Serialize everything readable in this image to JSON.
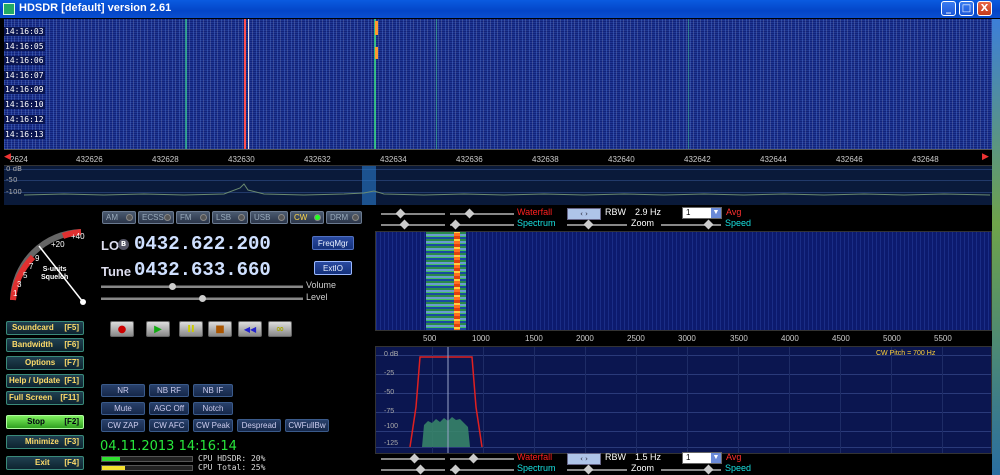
{
  "window": {
    "title": "HDSDR [default]  version 2.61",
    "min_glyph": "_",
    "max_glyph": "□",
    "close_glyph": "X"
  },
  "waterfall": {
    "timestamps": [
      "14:16:03",
      "14:16:05",
      "14:16:06",
      "14:16:07",
      "14:16:09",
      "14:16:10",
      "14:16:12",
      "14:16:13"
    ]
  },
  "freq_scale": {
    "labels": [
      "2624",
      "432626",
      "432628",
      "432630",
      "432632",
      "432634",
      "432636",
      "432638",
      "432640",
      "432642",
      "432644",
      "432646",
      "432648"
    ]
  },
  "spectrum_strip": {
    "labels": [
      "0 dB",
      "-50",
      "-100"
    ]
  },
  "smeter": {
    "scale_labels": [
      "+40",
      "+20",
      "9",
      "7",
      "5",
      "3",
      "1"
    ],
    "caption_1": "S-units",
    "caption_2": "Squelch"
  },
  "modes": [
    {
      "label": "AM"
    },
    {
      "label": "ECSS"
    },
    {
      "label": "FM"
    },
    {
      "label": "LSB"
    },
    {
      "label": "USB"
    },
    {
      "label": "CW",
      "active": true
    },
    {
      "label": "DRM"
    }
  ],
  "lo": {
    "label": "LO",
    "badge": "B",
    "value": "0432.622.200"
  },
  "tune": {
    "label": "Tune",
    "value": "0432.633.660"
  },
  "buttons": {
    "freqmgr": "FreqMgr",
    "extio": "ExtIO"
  },
  "sliders": {
    "volume": "Volume",
    "level": "Level",
    "volume_level": 0.35,
    "level_level": 0.5
  },
  "transport": {
    "record": "●",
    "play": "▶",
    "pause": "II",
    "stop": "■",
    "rewind": "◀◀",
    "loop": "∞"
  },
  "side_buttons": [
    {
      "label": "Soundcard",
      "key": "[F5]"
    },
    {
      "label": "Bandwidth",
      "key": "[F6]"
    },
    {
      "label": "Options",
      "key": "[F7]"
    },
    {
      "label": "Help / Update",
      "key": "[F1]"
    },
    {
      "label": "Full Screen",
      "key": "[F11]"
    },
    {
      "label": "Stop",
      "key": "[F2]"
    },
    {
      "label": "Minimize",
      "key": "[F3]"
    },
    {
      "label": "Exit",
      "key": "[F4]"
    }
  ],
  "dsp": {
    "row1": [
      "NR",
      "NB RF",
      "NB IF"
    ],
    "row2": [
      "Mute",
      "AGC Off",
      "Notch"
    ],
    "row3": [
      "CW ZAP",
      "CW AFC",
      "CW Peak",
      "Despread",
      "CWFullBw"
    ]
  },
  "status": {
    "clock": "04.11.2013 14:16:14",
    "cpu_hdsdr": "CPU HDSDR: 20%",
    "cpu_total": "CPU Total: 25%",
    "cpu_hdsdr_level": 0.2,
    "cpu_total_level": 0.25
  },
  "zoom_top": {
    "waterfall": "Waterfall",
    "spectrum": "Spectrum",
    "rbw_label": "RBW",
    "rbw_value": "2.9 Hz",
    "avg_value": "1",
    "avg_label": "Avg",
    "zoom": "Zoom",
    "speed": "Speed"
  },
  "zoom_bottom": {
    "waterfall": "Waterfall",
    "spectrum": "Spectrum",
    "rbw_label": "RBW",
    "rbw_value": "1.5 Hz",
    "avg_value": "1",
    "avg_label": "Avg",
    "zoom": "Zoom",
    "speed": "Speed"
  },
  "audio_scale": {
    "labels": [
      "500",
      "1000",
      "1500",
      "2000",
      "2500",
      "3000",
      "3500",
      "4000",
      "4500",
      "5000",
      "5500"
    ]
  },
  "audio_spectrum": {
    "db_labels": [
      "0 dB",
      "-25",
      "-50",
      "-75",
      "-100",
      "-125"
    ],
    "cw_pitch": "CW Pitch = 700 Hz"
  },
  "colors": {
    "accent_green": "#28e63c",
    "waterfall_red": "#ff2020",
    "spectrum_cyan": "#18e0e0",
    "avg_red": "#ff3030",
    "button_gold": "#ffdc6a"
  }
}
